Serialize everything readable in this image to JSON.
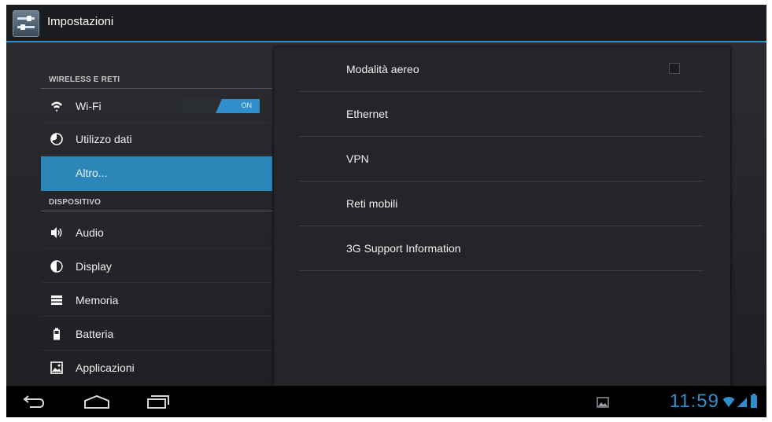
{
  "actionbar": {
    "title": "Impostazioni",
    "icon": "settings-icon"
  },
  "sidebar": {
    "sections": [
      {
        "header": "WIRELESS E RETI",
        "items": [
          {
            "label": "Wi-Fi",
            "icon": "wifi-icon",
            "toggle": "ON"
          },
          {
            "label": "Utilizzo dati",
            "icon": "data-usage-icon"
          },
          {
            "label": "Altro...",
            "icon": "",
            "selected": true
          }
        ]
      },
      {
        "header": "DISPOSITIVO",
        "items": [
          {
            "label": "Audio",
            "icon": "speaker-icon"
          },
          {
            "label": "Display",
            "icon": "display-icon"
          },
          {
            "label": "Memoria",
            "icon": "storage-icon"
          },
          {
            "label": "Batteria",
            "icon": "battery-icon"
          },
          {
            "label": "Applicazioni",
            "icon": "apps-icon"
          }
        ]
      }
    ]
  },
  "panel": {
    "rows": [
      {
        "label": "Modalità aereo",
        "checkbox": false
      },
      {
        "label": "Ethernet"
      },
      {
        "label": "VPN"
      },
      {
        "label": "Reti mobili"
      },
      {
        "label": "3G Support Information"
      }
    ]
  },
  "navbar": {
    "buttons": [
      "back-icon",
      "home-icon",
      "recent-apps-icon"
    ],
    "clock": "11:59",
    "status_icons": [
      "gallery-notification-icon",
      "wifi-signal-icon",
      "cell-signal-icon",
      "battery-status-icon"
    ]
  },
  "colors": {
    "accent": "#2f8ecb",
    "selected": "#2c86b8",
    "background": "#111214"
  }
}
